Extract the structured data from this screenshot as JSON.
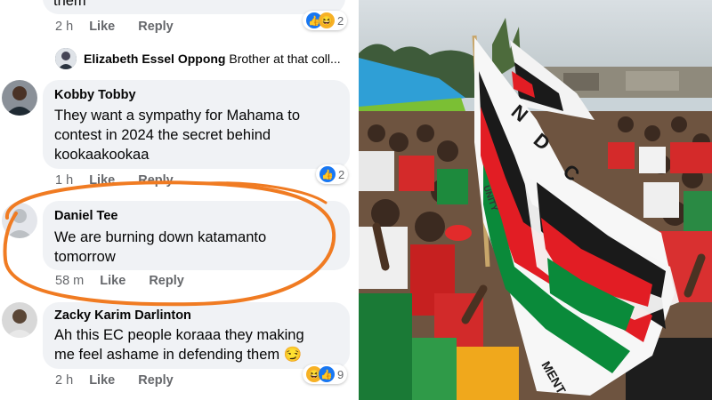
{
  "comments": [
    {
      "author": "",
      "text": "them",
      "time": "2 h",
      "like": "Like",
      "reply": "Reply",
      "reactions": "2"
    },
    {
      "author": "Elizabeth Essel Oppong",
      "text": "Brother at that coll..."
    },
    {
      "author": "Kobby Tobby",
      "lines": [
        "They want a sympathy for Mahama to",
        "contest in 2024 the secret behind",
        "kookaakookaa"
      ],
      "time": "1 h",
      "like": "Like",
      "reply": "Reply",
      "reactions": "2"
    },
    {
      "author": "Daniel Tee",
      "lines": [
        "We are burning down katamanto",
        "tomorrow"
      ],
      "time": "58 m",
      "like": "Like",
      "reply": "Reply"
    },
    {
      "author": "Zacky Karim Darlinton",
      "lines": [
        "Ah this EC people koraaa they making",
        "me feel ashame in defending them 😏"
      ],
      "time": "2 h",
      "like": "Like",
      "reply": "Reply",
      "reactions": "9"
    }
  ],
  "flag": {
    "letters": [
      "N",
      "D",
      "C"
    ],
    "bottom_text": "MENT",
    "side_text": "UNITY"
  },
  "colors": {
    "highlight": "#f07b22",
    "ndc_red": "#e21d24",
    "ndc_green": "#0a8a3a",
    "ndc_black": "#1a1a1a",
    "fb_blue": "#1877f2"
  }
}
